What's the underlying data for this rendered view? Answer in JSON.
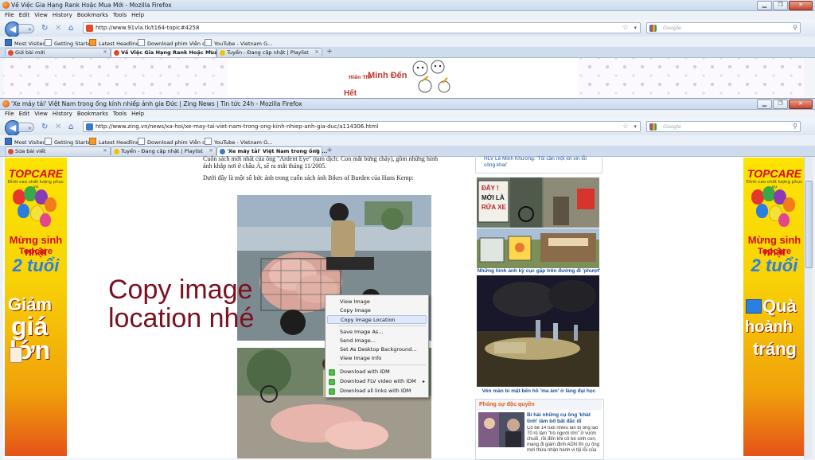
{
  "back_window": {
    "title": "Về Việc Gia Hạng Rank Hoặc Mua Mới - Mozilla Firefox",
    "menu": [
      "File",
      "Edit",
      "View",
      "History",
      "Bookmarks",
      "Tools",
      "Help"
    ],
    "url": "http://www.91vla.tk/t164-topic#4258",
    "search_placeholder": "Google",
    "bookmarks": [
      "Most Visited",
      "Getting Started",
      "Latest Headlines",
      "Download phim Viễn c...",
      "YouTube - Vietnam G..."
    ],
    "tabs": [
      {
        "label": "Gửi bài mới",
        "selected": false
      },
      {
        "label": "Về Việc Gia Hạng Rank Hoặc Mua ...",
        "selected": true
      },
      {
        "label": "Tuyển - Đang cập nhật | Playlist",
        "selected": false
      }
    ],
    "header_text": {
      "small": "Hiền Thì",
      "big": "Minh Đến",
      "sub": "Hết"
    }
  },
  "front_window": {
    "title": "'Xe máy tải' Việt Nam trong ống kính nhiếp ảnh gia Đức | Zing News | Tin tức 24h - Mozilla Firefox",
    "menu": [
      "File",
      "Edit",
      "View",
      "History",
      "Bookmarks",
      "Tools",
      "Help"
    ],
    "url": "http://www.zing.vn/news/xa-hoi/xe-may-tai-viet-nam-trong-ong-kinh-nhiep-anh-gia-duc/a114306.html",
    "search_placeholder": "Google",
    "bookmarks": [
      "Most Visited",
      "Getting Started",
      "Latest Headlines",
      "Download phim Viễn c...",
      "YouTube - Vietnam G..."
    ],
    "tabs": [
      {
        "label": "Sửa bài viết",
        "selected": false
      },
      {
        "label": "Tuyển - Đang cập nhật | Playlist",
        "selected": false
      },
      {
        "label": "'Xe máy tải' Việt Nam trong ống ...",
        "selected": true
      }
    ]
  },
  "article": {
    "para1": "Cuốn sách mới nhất của ông \"Ardent Eye\" (tạm dịch: Con mắt bừng cháy), gồm những hình ảnh khắp nơi ở châu Á, sẽ ra mắt tháng 11/2005.",
    "para2": "Dưới đây là một số bức ảnh trong cuốn sách ảnh Bikes of Burden của Hans Kemp:"
  },
  "overlay_text": {
    "line1": "Copy image",
    "line2": "location nhé"
  },
  "context_menu": {
    "items": [
      "View Image",
      "Copy Image",
      "Copy Image Location",
      "Save Image As...",
      "Send Image...",
      "Set As Desktop Background...",
      "View Image Info",
      "Download with IDM",
      "Download FLV video with IDM",
      "Download all links with IDM"
    ],
    "highlighted": "Copy Image Location"
  },
  "banner": {
    "brand": "TOPCARE",
    "tagline": "Đỉnh cao chất lượng phục vụ",
    "line1": "Mừng sinh nhật",
    "line2": "Topcare",
    "line3": "2 tuổi",
    "left_promo": [
      "Giảm",
      "giá",
      "lớn"
    ],
    "right_promo": [
      "Quà",
      "hoành",
      "tráng"
    ]
  },
  "sidebar": {
    "top_link": "HLV Lê Minh Khương: 'Tôi cần một lời xin lỗi công khai'",
    "sign_text1": "ĐẨY ! MỚI LÀ RỬA XE",
    "caption1": "Những hình ảnh kỳ cục gặp trên đường đi 'phượt'",
    "caption2": "Vén màn bí mật bến hồ 'ma ám' ở làng đại học",
    "section_title": "Phóng sự độc quyền",
    "story_title": "Bi hài những cụ ông 'khát tình' làm bố bất đắc dĩ",
    "story_text": "Cô bé 14 tuổi nhiều lần bị ông lão 70 rủ làm \"trò người lớn\" ở vườn chuối, rồi đến khi cô bé sinh con, mang đi giám định ADN thì cụ ông mới thừa nhận hành vi tội lỗi của"
  }
}
